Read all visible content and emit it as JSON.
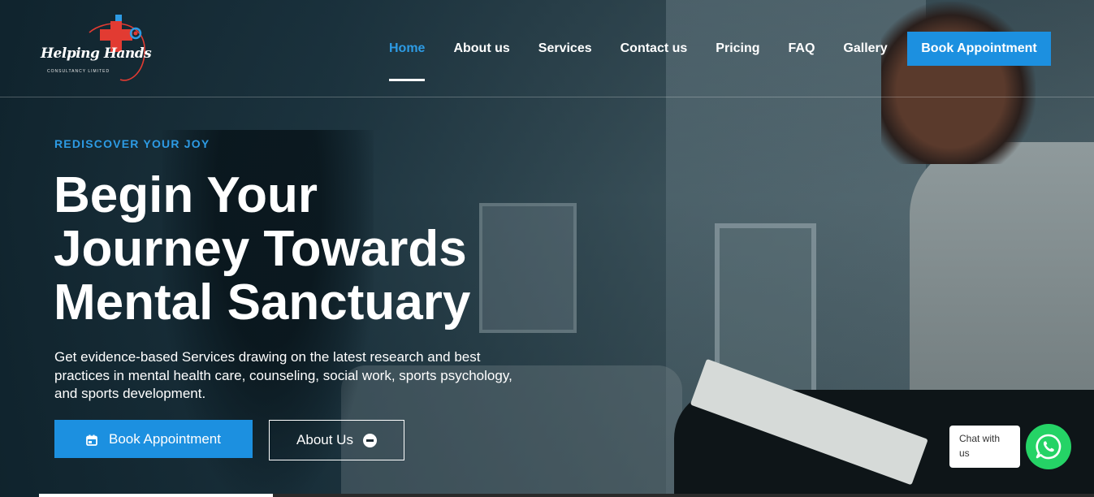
{
  "brand": {
    "name": "Helping Hands",
    "subtitle": "CONSULTANCY LIMITED",
    "accent_color": "#1c90e0",
    "logo_red": "#e23b32"
  },
  "nav": {
    "items": [
      {
        "label": "Home",
        "active": true
      },
      {
        "label": "About us",
        "active": false
      },
      {
        "label": "Services",
        "active": false
      },
      {
        "label": "Contact us",
        "active": false
      },
      {
        "label": "Pricing",
        "active": false
      },
      {
        "label": "FAQ",
        "active": false
      },
      {
        "label": "Gallery",
        "active": false
      }
    ],
    "cta_label": "Book Appointment"
  },
  "hero": {
    "eyebrow": "REDISCOVER YOUR JOY",
    "headline_lines": [
      "Begin Your",
      "Journey Towards",
      "Mental Sanctuary"
    ],
    "description": "Get evidence-based Services drawing on the latest research and best practices in mental health care, counseling, social work, sports psychology, and sports development.",
    "primary_button": {
      "label": "Book Appointment",
      "icon": "calendar-icon"
    },
    "secondary_button": {
      "label": "About Us",
      "icon": "minus-circle-icon"
    }
  },
  "chat": {
    "label": "Chat with us",
    "icon": "whatsapp-icon",
    "color": "#25d366"
  }
}
